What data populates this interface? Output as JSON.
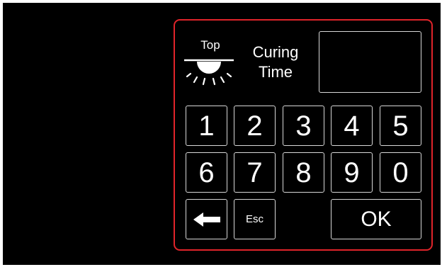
{
  "header": {
    "top_label": "Top",
    "title_line1": "Curing",
    "title_line2": "Time"
  },
  "display": {
    "value": ""
  },
  "keypad": {
    "digits": [
      "1",
      "2",
      "3",
      "4",
      "5",
      "6",
      "7",
      "8",
      "9",
      "0"
    ],
    "esc_label": "Esc",
    "ok_label": "OK",
    "backspace_icon": "left-arrow-icon"
  },
  "colors": {
    "screen_background": "#000000",
    "panel_border": "#e0242a",
    "foreground": "#ffffff"
  }
}
